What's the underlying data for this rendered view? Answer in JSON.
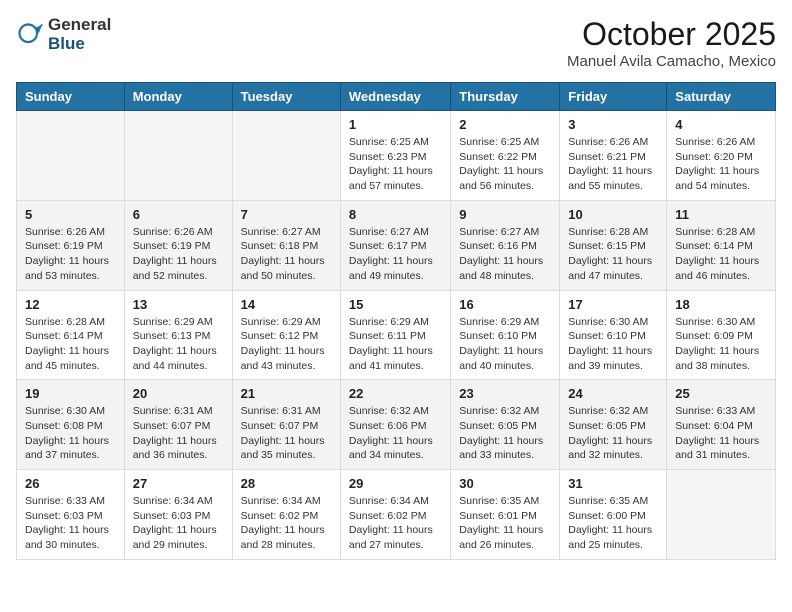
{
  "header": {
    "logo_general": "General",
    "logo_blue": "Blue",
    "month": "October 2025",
    "location": "Manuel Avila Camacho, Mexico"
  },
  "weekdays": [
    "Sunday",
    "Monday",
    "Tuesday",
    "Wednesday",
    "Thursday",
    "Friday",
    "Saturday"
  ],
  "weeks": [
    [
      {
        "day": "",
        "info": ""
      },
      {
        "day": "",
        "info": ""
      },
      {
        "day": "",
        "info": ""
      },
      {
        "day": "1",
        "info": "Sunrise: 6:25 AM\nSunset: 6:23 PM\nDaylight: 11 hours and 57 minutes."
      },
      {
        "day": "2",
        "info": "Sunrise: 6:25 AM\nSunset: 6:22 PM\nDaylight: 11 hours and 56 minutes."
      },
      {
        "day": "3",
        "info": "Sunrise: 6:26 AM\nSunset: 6:21 PM\nDaylight: 11 hours and 55 minutes."
      },
      {
        "day": "4",
        "info": "Sunrise: 6:26 AM\nSunset: 6:20 PM\nDaylight: 11 hours and 54 minutes."
      }
    ],
    [
      {
        "day": "5",
        "info": "Sunrise: 6:26 AM\nSunset: 6:19 PM\nDaylight: 11 hours and 53 minutes."
      },
      {
        "day": "6",
        "info": "Sunrise: 6:26 AM\nSunset: 6:19 PM\nDaylight: 11 hours and 52 minutes."
      },
      {
        "day": "7",
        "info": "Sunrise: 6:27 AM\nSunset: 6:18 PM\nDaylight: 11 hours and 50 minutes."
      },
      {
        "day": "8",
        "info": "Sunrise: 6:27 AM\nSunset: 6:17 PM\nDaylight: 11 hours and 49 minutes."
      },
      {
        "day": "9",
        "info": "Sunrise: 6:27 AM\nSunset: 6:16 PM\nDaylight: 11 hours and 48 minutes."
      },
      {
        "day": "10",
        "info": "Sunrise: 6:28 AM\nSunset: 6:15 PM\nDaylight: 11 hours and 47 minutes."
      },
      {
        "day": "11",
        "info": "Sunrise: 6:28 AM\nSunset: 6:14 PM\nDaylight: 11 hours and 46 minutes."
      }
    ],
    [
      {
        "day": "12",
        "info": "Sunrise: 6:28 AM\nSunset: 6:14 PM\nDaylight: 11 hours and 45 minutes."
      },
      {
        "day": "13",
        "info": "Sunrise: 6:29 AM\nSunset: 6:13 PM\nDaylight: 11 hours and 44 minutes."
      },
      {
        "day": "14",
        "info": "Sunrise: 6:29 AM\nSunset: 6:12 PM\nDaylight: 11 hours and 43 minutes."
      },
      {
        "day": "15",
        "info": "Sunrise: 6:29 AM\nSunset: 6:11 PM\nDaylight: 11 hours and 41 minutes."
      },
      {
        "day": "16",
        "info": "Sunrise: 6:29 AM\nSunset: 6:10 PM\nDaylight: 11 hours and 40 minutes."
      },
      {
        "day": "17",
        "info": "Sunrise: 6:30 AM\nSunset: 6:10 PM\nDaylight: 11 hours and 39 minutes."
      },
      {
        "day": "18",
        "info": "Sunrise: 6:30 AM\nSunset: 6:09 PM\nDaylight: 11 hours and 38 minutes."
      }
    ],
    [
      {
        "day": "19",
        "info": "Sunrise: 6:30 AM\nSunset: 6:08 PM\nDaylight: 11 hours and 37 minutes."
      },
      {
        "day": "20",
        "info": "Sunrise: 6:31 AM\nSunset: 6:07 PM\nDaylight: 11 hours and 36 minutes."
      },
      {
        "day": "21",
        "info": "Sunrise: 6:31 AM\nSunset: 6:07 PM\nDaylight: 11 hours and 35 minutes."
      },
      {
        "day": "22",
        "info": "Sunrise: 6:32 AM\nSunset: 6:06 PM\nDaylight: 11 hours and 34 minutes."
      },
      {
        "day": "23",
        "info": "Sunrise: 6:32 AM\nSunset: 6:05 PM\nDaylight: 11 hours and 33 minutes."
      },
      {
        "day": "24",
        "info": "Sunrise: 6:32 AM\nSunset: 6:05 PM\nDaylight: 11 hours and 32 minutes."
      },
      {
        "day": "25",
        "info": "Sunrise: 6:33 AM\nSunset: 6:04 PM\nDaylight: 11 hours and 31 minutes."
      }
    ],
    [
      {
        "day": "26",
        "info": "Sunrise: 6:33 AM\nSunset: 6:03 PM\nDaylight: 11 hours and 30 minutes."
      },
      {
        "day": "27",
        "info": "Sunrise: 6:34 AM\nSunset: 6:03 PM\nDaylight: 11 hours and 29 minutes."
      },
      {
        "day": "28",
        "info": "Sunrise: 6:34 AM\nSunset: 6:02 PM\nDaylight: 11 hours and 28 minutes."
      },
      {
        "day": "29",
        "info": "Sunrise: 6:34 AM\nSunset: 6:02 PM\nDaylight: 11 hours and 27 minutes."
      },
      {
        "day": "30",
        "info": "Sunrise: 6:35 AM\nSunset: 6:01 PM\nDaylight: 11 hours and 26 minutes."
      },
      {
        "day": "31",
        "info": "Sunrise: 6:35 AM\nSunset: 6:00 PM\nDaylight: 11 hours and 25 minutes."
      },
      {
        "day": "",
        "info": ""
      }
    ]
  ]
}
